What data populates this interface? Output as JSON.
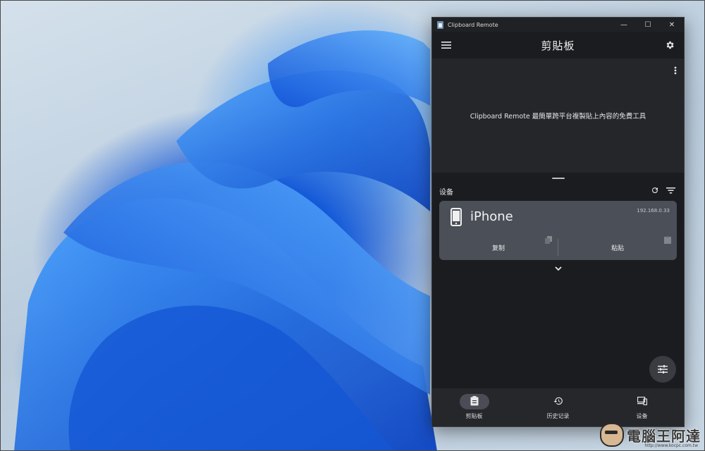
{
  "window": {
    "title": "Clipboard Remote",
    "controls": {
      "minimize": "—",
      "maximize": "☐",
      "close": "✕"
    }
  },
  "appbar": {
    "title": "剪貼板"
  },
  "clipboard_panel": {
    "message": "Clipboard Remote 最簡單跨平台複製貼上內容的免費工具"
  },
  "devices": {
    "heading": "设备",
    "items": [
      {
        "name": "iPhone",
        "ip": "192.168.0.33",
        "copy_label": "复制",
        "paste_label": "粘贴"
      }
    ]
  },
  "bottom_nav": {
    "items": [
      {
        "label": "剪贴板",
        "icon": "clipboard-icon",
        "active": true
      },
      {
        "label": "历史记录",
        "icon": "history-icon",
        "active": false
      },
      {
        "label": "设备",
        "icon": "devices-icon",
        "active": false
      }
    ]
  },
  "watermark": {
    "text": "電腦王阿達",
    "url": "http://www.kocpc.com.tw"
  },
  "colors": {
    "window_bg": "#1b1c1f",
    "panel_bg": "#25262a",
    "card_bg": "#4b4f57",
    "nav_bg": "#26272b",
    "wallpaper_accent": "#1a6fe8"
  }
}
